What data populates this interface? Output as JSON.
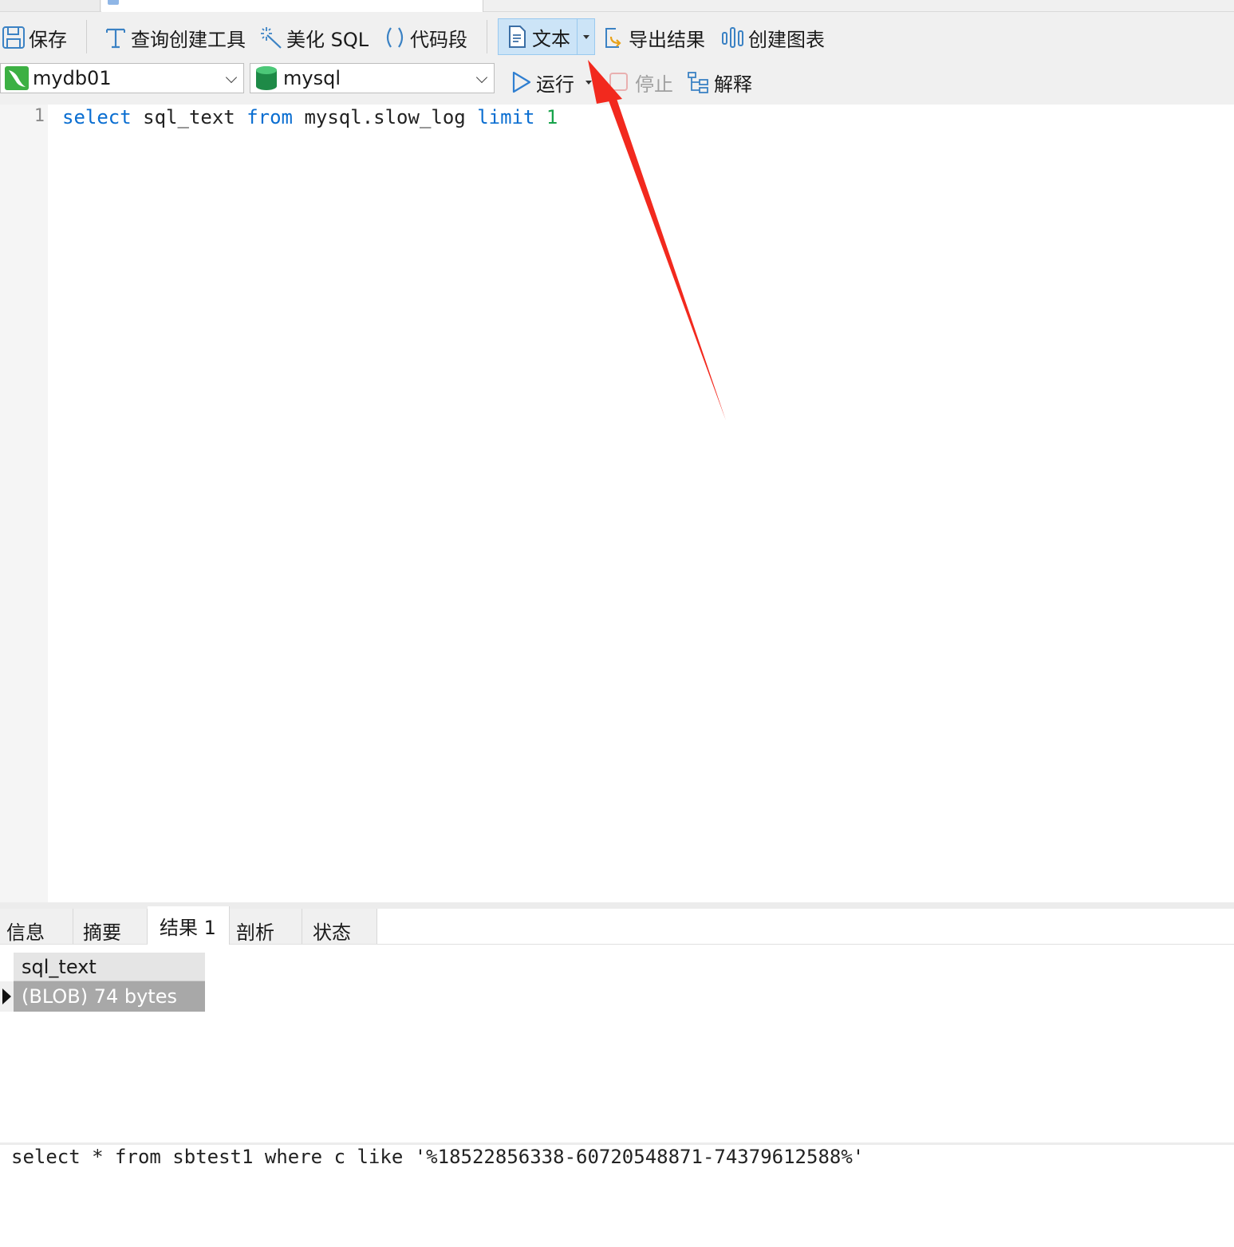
{
  "toolbar": {
    "save_label": "保存",
    "query_builder_label": "查询创建工具",
    "beautify_label": "美化 SQL",
    "snippet_label": "代码段",
    "text_label": "文本",
    "export_label": "导出结果",
    "chart_label": "创建图表",
    "run_label": "运行",
    "stop_label": "停止",
    "explain_label": "解释"
  },
  "connection": {
    "selected": "mydb01"
  },
  "database": {
    "selected": "mysql"
  },
  "editor": {
    "line_number": "1",
    "tokens": {
      "select": "select",
      "col": " sql_text ",
      "from": "from",
      "table": " mysql.slow_log ",
      "limit": "limit",
      "num": "1"
    }
  },
  "result_tabs": [
    "信息",
    "摘要",
    "结果 1",
    "剖析",
    "状态"
  ],
  "grid": {
    "column": "sql_text",
    "cell": "(BLOB) 74 bytes"
  },
  "blob_viewer": {
    "text": "select * from sbtest1 where c like '%18522856338-60720548871-74379612588%'"
  },
  "colors": {
    "keyword": "#0a6ed1",
    "number": "#17a34a",
    "annotation_arrow": "#f2291e",
    "selected_button": "#cce4f7"
  }
}
